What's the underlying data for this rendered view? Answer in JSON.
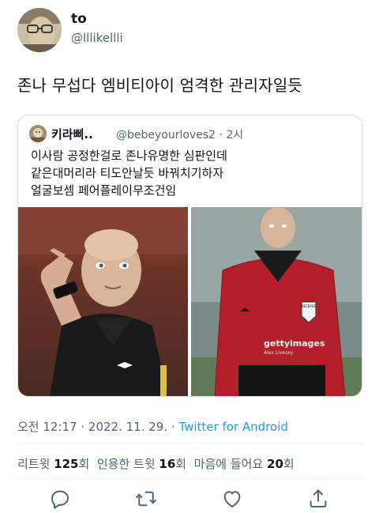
{
  "author": {
    "name": "to",
    "handle": "@lllikellli"
  },
  "tweet_text": "존나 무섭다 엠비티아이 엄격한 관리자일듯",
  "quote": {
    "name": "키라삐..",
    "handle": "@bebeyourloves2",
    "time": "· 2시",
    "lines": [
      "이사람 공정한걸로 존나유명한 심판인데",
      "같은대머리라 티도안날듯 바꿔치기하자",
      "얼굴보셈 페어플레이무조건임"
    ],
    "image_right": {
      "watermark": "gettyimages",
      "credit": "Alex Livesey",
      "badge": "REFEREE"
    }
  },
  "meta": {
    "time": "오전 12:17",
    "sep1": " · ",
    "date": "2022. 11. 29.",
    "sep2": " · ",
    "source": "Twitter for Android"
  },
  "stats": {
    "retweets_label": "리트윗",
    "retweets": "125",
    "retweets_unit": "회",
    "quotes_label": "인용한 트윗",
    "quotes": "16",
    "quotes_unit": "회",
    "likes_label": "마음에 들어요",
    "likes": "20",
    "likes_unit": "회"
  },
  "actions": [
    "reply-icon",
    "retweet-icon",
    "like-icon",
    "share-icon"
  ],
  "colors": {
    "link": "#1d9bf0",
    "muted": "#536471",
    "border": "#cfd9de"
  }
}
